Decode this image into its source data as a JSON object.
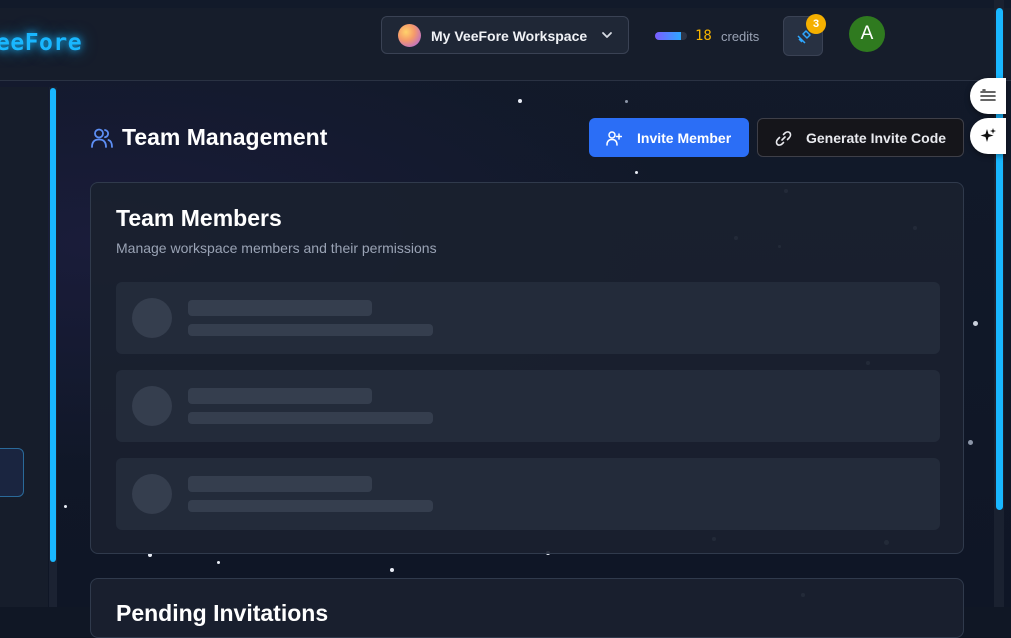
{
  "header": {
    "logo_text": "eeFore",
    "workspace_name": "My VeeFore Workspace",
    "credits_value": "18",
    "credits_label": "credits",
    "credits_fill_percent": 80,
    "notification_count": "3",
    "user_initial": "A"
  },
  "main": {
    "page_title": "Team Management",
    "invite_button": "Invite Member",
    "generate_code_button": "Generate Invite Code",
    "members_card": {
      "title": "Team Members",
      "subtitle": "Manage workspace members and their permissions",
      "loading_rows": 3
    },
    "pending_card": {
      "title": "Pending Invitations"
    }
  },
  "colors": {
    "accent": "#19b7ff",
    "primary_button": "#2b6ef6",
    "badge": "#f5b000",
    "credits_text": "#f5b300",
    "avatar_green": "#2f7a1f"
  },
  "icons": {
    "workspace": "workspace-avatar-icon",
    "chevron": "chevron-down-icon",
    "notification": "satellite-icon",
    "title": "users-icon",
    "invite": "user-plus-icon",
    "link": "link-icon",
    "float_top": "list-icon",
    "float_bottom": "sparkles-icon"
  }
}
